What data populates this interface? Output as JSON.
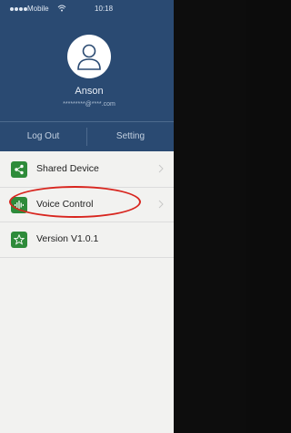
{
  "status_bar": {
    "carrier": "Mobile",
    "time": "10:18"
  },
  "profile": {
    "username": "Anson",
    "email": "*********@****.com"
  },
  "actions": {
    "logout_label": "Log Out",
    "setting_label": "Setting"
  },
  "menu": {
    "items": [
      {
        "label": "Shared Device",
        "icon": "share-icon",
        "has_chevron": true
      },
      {
        "label": "Voice Control",
        "icon": "voice-wave-icon",
        "has_chevron": true
      },
      {
        "label": "Version V1.0.1",
        "icon": "star-icon",
        "has_chevron": false
      }
    ]
  },
  "colors": {
    "header_bg": "#2a4a72",
    "icon_green": "#2e8b3a",
    "highlight_red": "#d8261f"
  }
}
